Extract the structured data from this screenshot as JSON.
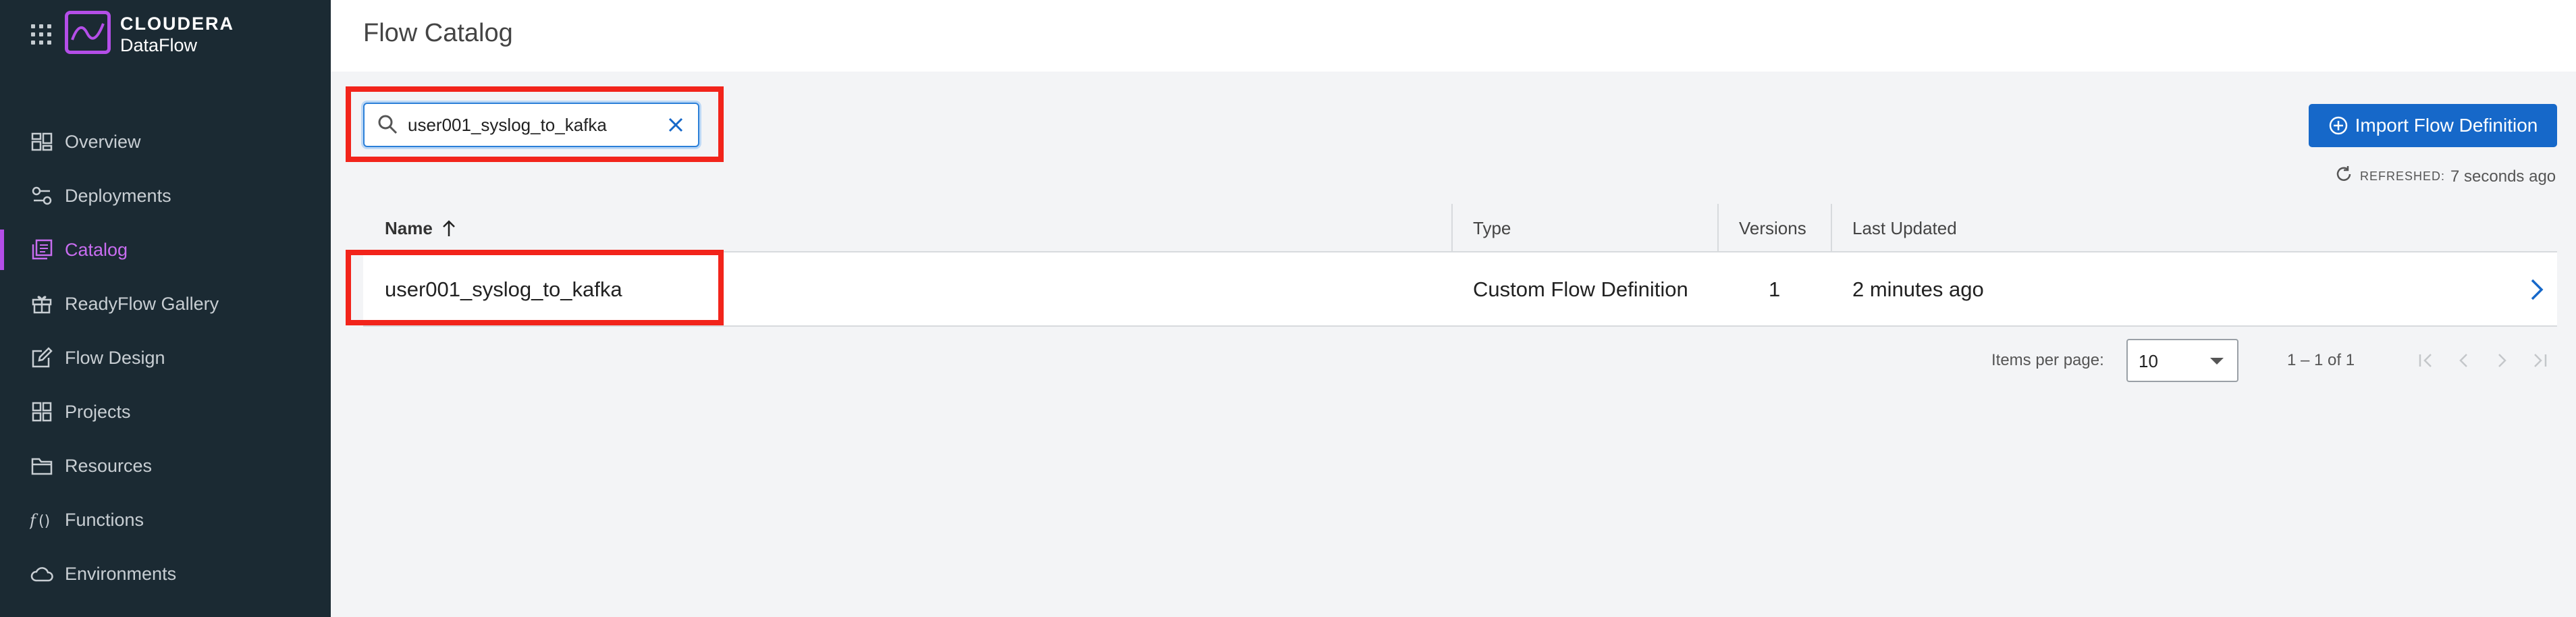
{
  "app": {
    "brand_top": "CLOUDERA",
    "brand_bottom": "DataFlow"
  },
  "sidebar": {
    "items": [
      {
        "label": "Overview",
        "icon": "overview-icon",
        "active": false
      },
      {
        "label": "Deployments",
        "icon": "deployments-icon",
        "active": false
      },
      {
        "label": "Catalog",
        "icon": "catalog-icon",
        "active": true
      },
      {
        "label": "ReadyFlow Gallery",
        "icon": "gift-icon",
        "active": false
      },
      {
        "label": "Flow Design",
        "icon": "edit-icon",
        "active": false
      },
      {
        "label": "Projects",
        "icon": "projects-icon",
        "active": false
      },
      {
        "label": "Resources",
        "icon": "folder-icon",
        "active": false
      },
      {
        "label": "Functions",
        "icon": "function-icon",
        "active": false
      },
      {
        "label": "Environments",
        "icon": "cloud-icon",
        "active": false
      }
    ]
  },
  "header": {
    "title": "Flow Catalog"
  },
  "search": {
    "value": "user001_syslog_to_kafka"
  },
  "toolbar": {
    "import_label": "Import Flow Definition"
  },
  "status": {
    "refreshed_label": "REFRESHED:",
    "refreshed_value": "7 seconds ago"
  },
  "table": {
    "columns": {
      "name": "Name",
      "type": "Type",
      "versions": "Versions",
      "last_updated": "Last Updated"
    },
    "rows": [
      {
        "name": "user001_syslog_to_kafka",
        "type": "Custom Flow Definition",
        "versions": "1",
        "last_updated": "2 minutes ago"
      }
    ]
  },
  "pagination": {
    "items_per_page_label": "Items per page:",
    "items_per_page": "10",
    "range": "1 – 1 of 1"
  },
  "colors": {
    "sidebar_bg": "#1b2a33",
    "accent_purple": "#b44ee8",
    "primary_blue": "#1668c9",
    "highlight_red": "#f2241b"
  }
}
